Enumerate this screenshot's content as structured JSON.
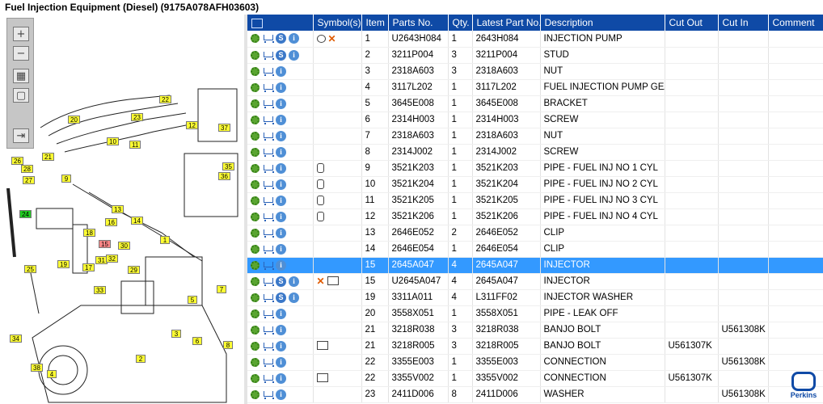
{
  "window": {
    "title": "Fuel Injection Equipment (Diesel) (9175A078AFH03603)"
  },
  "colors": {
    "header_bg": "#0f4aa6",
    "selected_row": "#3399ff",
    "callout": "#ffff33",
    "callout_highlight": "#22cc22",
    "callout_selected": "#ff8888"
  },
  "zoom": {
    "zoom_in_icon": "zoom-in-icon",
    "zoom_out_icon": "zoom-out-icon",
    "fit_icon": "fit-icon",
    "actual_size_icon": "actual-size-icon",
    "expand_icon": "expand-icon"
  },
  "diagram": {
    "callouts": [
      {
        "label": "22"
      },
      {
        "label": "23"
      },
      {
        "label": "20"
      },
      {
        "label": "12"
      },
      {
        "label": "37"
      },
      {
        "label": "10"
      },
      {
        "label": "11"
      },
      {
        "label": "21"
      },
      {
        "label": "26"
      },
      {
        "label": "28"
      },
      {
        "label": "27"
      },
      {
        "label": "9"
      },
      {
        "label": "35"
      },
      {
        "label": "36"
      },
      {
        "label": "24"
      },
      {
        "label": "13"
      },
      {
        "label": "14"
      },
      {
        "label": "16"
      },
      {
        "label": "18"
      },
      {
        "label": "15"
      },
      {
        "label": "30"
      },
      {
        "label": "1"
      },
      {
        "label": "25"
      },
      {
        "label": "19"
      },
      {
        "label": "17"
      },
      {
        "label": "31"
      },
      {
        "label": "32"
      },
      {
        "label": "29"
      },
      {
        "label": "33"
      },
      {
        "label": "7"
      },
      {
        "label": "5"
      },
      {
        "label": "3"
      },
      {
        "label": "6"
      },
      {
        "label": "8"
      },
      {
        "label": "34"
      },
      {
        "label": "2"
      },
      {
        "label": "38"
      },
      {
        "label": "4"
      }
    ]
  },
  "table": {
    "columns": [
      "Symbol(s)",
      "Item",
      "Parts No.",
      "Qty.",
      "Latest Part No.",
      "Description",
      "Cut Out",
      "Cut In",
      "Comment"
    ],
    "header_icon": "search-grid-icon",
    "rows": [
      {
        "service": true,
        "symbols": [
          "bubble-icon",
          "cross-icon"
        ],
        "item": "1",
        "part": "U2643H084",
        "qty": "1",
        "latest": "2643H084",
        "desc": "INJECTION PUMP",
        "cut_out": "",
        "cut_in": "",
        "comment": ""
      },
      {
        "service": true,
        "symbols": [],
        "item": "2",
        "part": "3211P004",
        "qty": "3",
        "latest": "3211P004",
        "desc": "STUD",
        "cut_out": "",
        "cut_in": "",
        "comment": ""
      },
      {
        "service": false,
        "symbols": [],
        "item": "3",
        "part": "2318A603",
        "qty": "3",
        "latest": "2318A603",
        "desc": "NUT",
        "cut_out": "",
        "cut_in": "",
        "comment": ""
      },
      {
        "service": false,
        "symbols": [],
        "item": "4",
        "part": "3117L202",
        "qty": "1",
        "latest": "3117L202",
        "desc": "FUEL INJECTION PUMP GEAR",
        "cut_out": "",
        "cut_in": "",
        "comment": ""
      },
      {
        "service": false,
        "symbols": [],
        "item": "5",
        "part": "3645E008",
        "qty": "1",
        "latest": "3645E008",
        "desc": "BRACKET",
        "cut_out": "",
        "cut_in": "",
        "comment": ""
      },
      {
        "service": false,
        "symbols": [],
        "item": "6",
        "part": "2314H003",
        "qty": "1",
        "latest": "2314H003",
        "desc": "SCREW",
        "cut_out": "",
        "cut_in": "",
        "comment": ""
      },
      {
        "service": false,
        "symbols": [],
        "item": "7",
        "part": "2318A603",
        "qty": "1",
        "latest": "2318A603",
        "desc": "NUT",
        "cut_out": "",
        "cut_in": "",
        "comment": ""
      },
      {
        "service": false,
        "symbols": [],
        "item": "8",
        "part": "2314J002",
        "qty": "1",
        "latest": "2314J002",
        "desc": "SCREW",
        "cut_out": "",
        "cut_in": "",
        "comment": ""
      },
      {
        "service": false,
        "symbols": [
          "cylinder-icon"
        ],
        "item": "9",
        "part": "3521K203",
        "qty": "1",
        "latest": "3521K203",
        "desc": "PIPE - FUEL INJ NO 1 CYL",
        "cut_out": "",
        "cut_in": "",
        "comment": ""
      },
      {
        "service": false,
        "symbols": [
          "cylinder-icon"
        ],
        "item": "10",
        "part": "3521K204",
        "qty": "1",
        "latest": "3521K204",
        "desc": "PIPE - FUEL INJ NO 2 CYL",
        "cut_out": "",
        "cut_in": "",
        "comment": ""
      },
      {
        "service": false,
        "symbols": [
          "cylinder-icon"
        ],
        "item": "11",
        "part": "3521K205",
        "qty": "1",
        "latest": "3521K205",
        "desc": "PIPE - FUEL INJ NO 3 CYL",
        "cut_out": "",
        "cut_in": "",
        "comment": ""
      },
      {
        "service": false,
        "symbols": [
          "cylinder-icon"
        ],
        "item": "12",
        "part": "3521K206",
        "qty": "1",
        "latest": "3521K206",
        "desc": "PIPE - FUEL INJ NO 4 CYL",
        "cut_out": "",
        "cut_in": "",
        "comment": ""
      },
      {
        "service": false,
        "symbols": [],
        "item": "13",
        "part": "2646E052",
        "qty": "2",
        "latest": "2646E052",
        "desc": "CLIP",
        "cut_out": "",
        "cut_in": "",
        "comment": ""
      },
      {
        "service": false,
        "symbols": [],
        "item": "14",
        "part": "2646E054",
        "qty": "1",
        "latest": "2646E054",
        "desc": "CLIP",
        "cut_out": "",
        "cut_in": "",
        "comment": ""
      },
      {
        "service": false,
        "selected": true,
        "symbols": [],
        "item": "15",
        "part": "2645A047",
        "qty": "4",
        "latest": "2645A047",
        "desc": "INJECTOR",
        "cut_out": "",
        "cut_in": "",
        "comment": ""
      },
      {
        "service": true,
        "symbols": [
          "cross-icon",
          "magnify-icon"
        ],
        "item": "15",
        "part": "U2645A047",
        "qty": "4",
        "latest": "2645A047",
        "desc": "INJECTOR",
        "cut_out": "",
        "cut_in": "",
        "comment": ""
      },
      {
        "service": true,
        "symbols": [],
        "item": "19",
        "part": "3311A011",
        "qty": "4",
        "latest": "L311FF02",
        "desc": "INJECTOR WASHER",
        "cut_out": "",
        "cut_in": "",
        "comment": ""
      },
      {
        "service": false,
        "symbols": [],
        "item": "20",
        "part": "3558X051",
        "qty": "1",
        "latest": "3558X051",
        "desc": "PIPE - LEAK OFF",
        "cut_out": "",
        "cut_in": "",
        "comment": ""
      },
      {
        "service": false,
        "symbols": [],
        "item": "21",
        "part": "3218R038",
        "qty": "3",
        "latest": "3218R038",
        "desc": "BANJO BOLT",
        "cut_out": "",
        "cut_in": "U561308K",
        "comment": ""
      },
      {
        "service": false,
        "symbols": [
          "magnify-icon"
        ],
        "item": "21",
        "part": "3218R005",
        "qty": "3",
        "latest": "3218R005",
        "desc": "BANJO BOLT",
        "cut_out": "U561307K",
        "cut_in": "",
        "comment": ""
      },
      {
        "service": false,
        "symbols": [],
        "item": "22",
        "part": "3355E003",
        "qty": "1",
        "latest": "3355E003",
        "desc": "CONNECTION",
        "cut_out": "",
        "cut_in": "U561308K",
        "comment": ""
      },
      {
        "service": false,
        "symbols": [
          "magnify-icon"
        ],
        "item": "22",
        "part": "3355V002",
        "qty": "1",
        "latest": "3355V002",
        "desc": "CONNECTION",
        "cut_out": "U561307K",
        "cut_in": "",
        "comment": ""
      },
      {
        "service": false,
        "symbols": [],
        "item": "23",
        "part": "2411D006",
        "qty": "8",
        "latest": "2411D006",
        "desc": "WASHER",
        "cut_out": "",
        "cut_in": "U561308K",
        "comment": ""
      }
    ]
  },
  "logo": {
    "brand": "Perkins"
  }
}
